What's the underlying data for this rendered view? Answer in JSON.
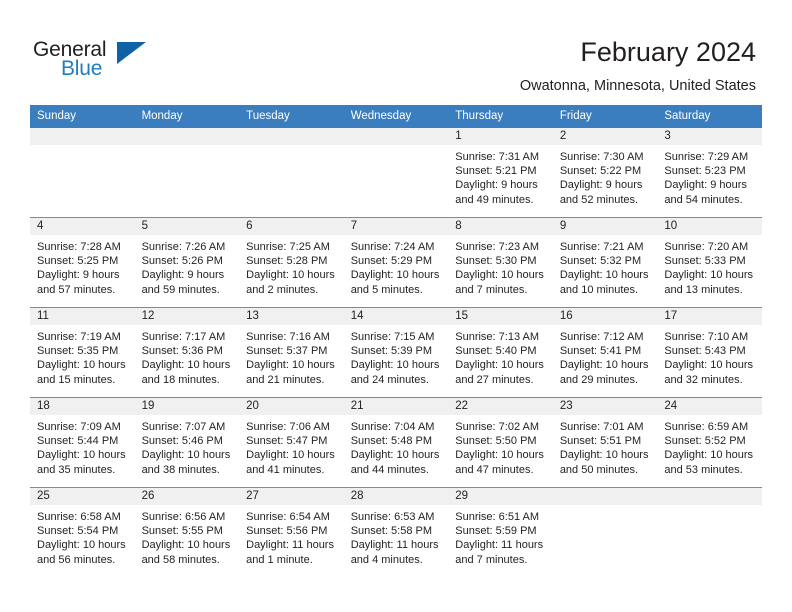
{
  "brand": {
    "name_part1": "General",
    "name_part2": "Blue",
    "accent_color": "#1f7dc4",
    "triangle_color": "#1161a6"
  },
  "header": {
    "title": "February 2024",
    "subtitle": "Owatonna, Minnesota, United States"
  },
  "calendar": {
    "header_bg": "#3a7ebf",
    "daynum_bg": "#f0f0f0",
    "weekday_headers": [
      "Sunday",
      "Monday",
      "Tuesday",
      "Wednesday",
      "Thursday",
      "Friday",
      "Saturday"
    ],
    "weeks": [
      [
        {
          "day": "",
          "lines": []
        },
        {
          "day": "",
          "lines": []
        },
        {
          "day": "",
          "lines": []
        },
        {
          "day": "",
          "lines": []
        },
        {
          "day": "1",
          "lines": [
            "Sunrise: 7:31 AM",
            "Sunset: 5:21 PM",
            "Daylight: 9 hours",
            "and 49 minutes."
          ]
        },
        {
          "day": "2",
          "lines": [
            "Sunrise: 7:30 AM",
            "Sunset: 5:22 PM",
            "Daylight: 9 hours",
            "and 52 minutes."
          ]
        },
        {
          "day": "3",
          "lines": [
            "Sunrise: 7:29 AM",
            "Sunset: 5:23 PM",
            "Daylight: 9 hours",
            "and 54 minutes."
          ]
        }
      ],
      [
        {
          "day": "4",
          "lines": [
            "Sunrise: 7:28 AM",
            "Sunset: 5:25 PM",
            "Daylight: 9 hours",
            "and 57 minutes."
          ]
        },
        {
          "day": "5",
          "lines": [
            "Sunrise: 7:26 AM",
            "Sunset: 5:26 PM",
            "Daylight: 9 hours",
            "and 59 minutes."
          ]
        },
        {
          "day": "6",
          "lines": [
            "Sunrise: 7:25 AM",
            "Sunset: 5:28 PM",
            "Daylight: 10 hours",
            "and 2 minutes."
          ]
        },
        {
          "day": "7",
          "lines": [
            "Sunrise: 7:24 AM",
            "Sunset: 5:29 PM",
            "Daylight: 10 hours",
            "and 5 minutes."
          ]
        },
        {
          "day": "8",
          "lines": [
            "Sunrise: 7:23 AM",
            "Sunset: 5:30 PM",
            "Daylight: 10 hours",
            "and 7 minutes."
          ]
        },
        {
          "day": "9",
          "lines": [
            "Sunrise: 7:21 AM",
            "Sunset: 5:32 PM",
            "Daylight: 10 hours",
            "and 10 minutes."
          ]
        },
        {
          "day": "10",
          "lines": [
            "Sunrise: 7:20 AM",
            "Sunset: 5:33 PM",
            "Daylight: 10 hours",
            "and 13 minutes."
          ]
        }
      ],
      [
        {
          "day": "11",
          "lines": [
            "Sunrise: 7:19 AM",
            "Sunset: 5:35 PM",
            "Daylight: 10 hours",
            "and 15 minutes."
          ]
        },
        {
          "day": "12",
          "lines": [
            "Sunrise: 7:17 AM",
            "Sunset: 5:36 PM",
            "Daylight: 10 hours",
            "and 18 minutes."
          ]
        },
        {
          "day": "13",
          "lines": [
            "Sunrise: 7:16 AM",
            "Sunset: 5:37 PM",
            "Daylight: 10 hours",
            "and 21 minutes."
          ]
        },
        {
          "day": "14",
          "lines": [
            "Sunrise: 7:15 AM",
            "Sunset: 5:39 PM",
            "Daylight: 10 hours",
            "and 24 minutes."
          ]
        },
        {
          "day": "15",
          "lines": [
            "Sunrise: 7:13 AM",
            "Sunset: 5:40 PM",
            "Daylight: 10 hours",
            "and 27 minutes."
          ]
        },
        {
          "day": "16",
          "lines": [
            "Sunrise: 7:12 AM",
            "Sunset: 5:41 PM",
            "Daylight: 10 hours",
            "and 29 minutes."
          ]
        },
        {
          "day": "17",
          "lines": [
            "Sunrise: 7:10 AM",
            "Sunset: 5:43 PM",
            "Daylight: 10 hours",
            "and 32 minutes."
          ]
        }
      ],
      [
        {
          "day": "18",
          "lines": [
            "Sunrise: 7:09 AM",
            "Sunset: 5:44 PM",
            "Daylight: 10 hours",
            "and 35 minutes."
          ]
        },
        {
          "day": "19",
          "lines": [
            "Sunrise: 7:07 AM",
            "Sunset: 5:46 PM",
            "Daylight: 10 hours",
            "and 38 minutes."
          ]
        },
        {
          "day": "20",
          "lines": [
            "Sunrise: 7:06 AM",
            "Sunset: 5:47 PM",
            "Daylight: 10 hours",
            "and 41 minutes."
          ]
        },
        {
          "day": "21",
          "lines": [
            "Sunrise: 7:04 AM",
            "Sunset: 5:48 PM",
            "Daylight: 10 hours",
            "and 44 minutes."
          ]
        },
        {
          "day": "22",
          "lines": [
            "Sunrise: 7:02 AM",
            "Sunset: 5:50 PM",
            "Daylight: 10 hours",
            "and 47 minutes."
          ]
        },
        {
          "day": "23",
          "lines": [
            "Sunrise: 7:01 AM",
            "Sunset: 5:51 PM",
            "Daylight: 10 hours",
            "and 50 minutes."
          ]
        },
        {
          "day": "24",
          "lines": [
            "Sunrise: 6:59 AM",
            "Sunset: 5:52 PM",
            "Daylight: 10 hours",
            "and 53 minutes."
          ]
        }
      ],
      [
        {
          "day": "25",
          "lines": [
            "Sunrise: 6:58 AM",
            "Sunset: 5:54 PM",
            "Daylight: 10 hours",
            "and 56 minutes."
          ]
        },
        {
          "day": "26",
          "lines": [
            "Sunrise: 6:56 AM",
            "Sunset: 5:55 PM",
            "Daylight: 10 hours",
            "and 58 minutes."
          ]
        },
        {
          "day": "27",
          "lines": [
            "Sunrise: 6:54 AM",
            "Sunset: 5:56 PM",
            "Daylight: 11 hours",
            "and 1 minute."
          ]
        },
        {
          "day": "28",
          "lines": [
            "Sunrise: 6:53 AM",
            "Sunset: 5:58 PM",
            "Daylight: 11 hours",
            "and 4 minutes."
          ]
        },
        {
          "day": "29",
          "lines": [
            "Sunrise: 6:51 AM",
            "Sunset: 5:59 PM",
            "Daylight: 11 hours",
            "and 7 minutes."
          ]
        },
        {
          "day": "",
          "lines": []
        },
        {
          "day": "",
          "lines": []
        }
      ]
    ]
  }
}
